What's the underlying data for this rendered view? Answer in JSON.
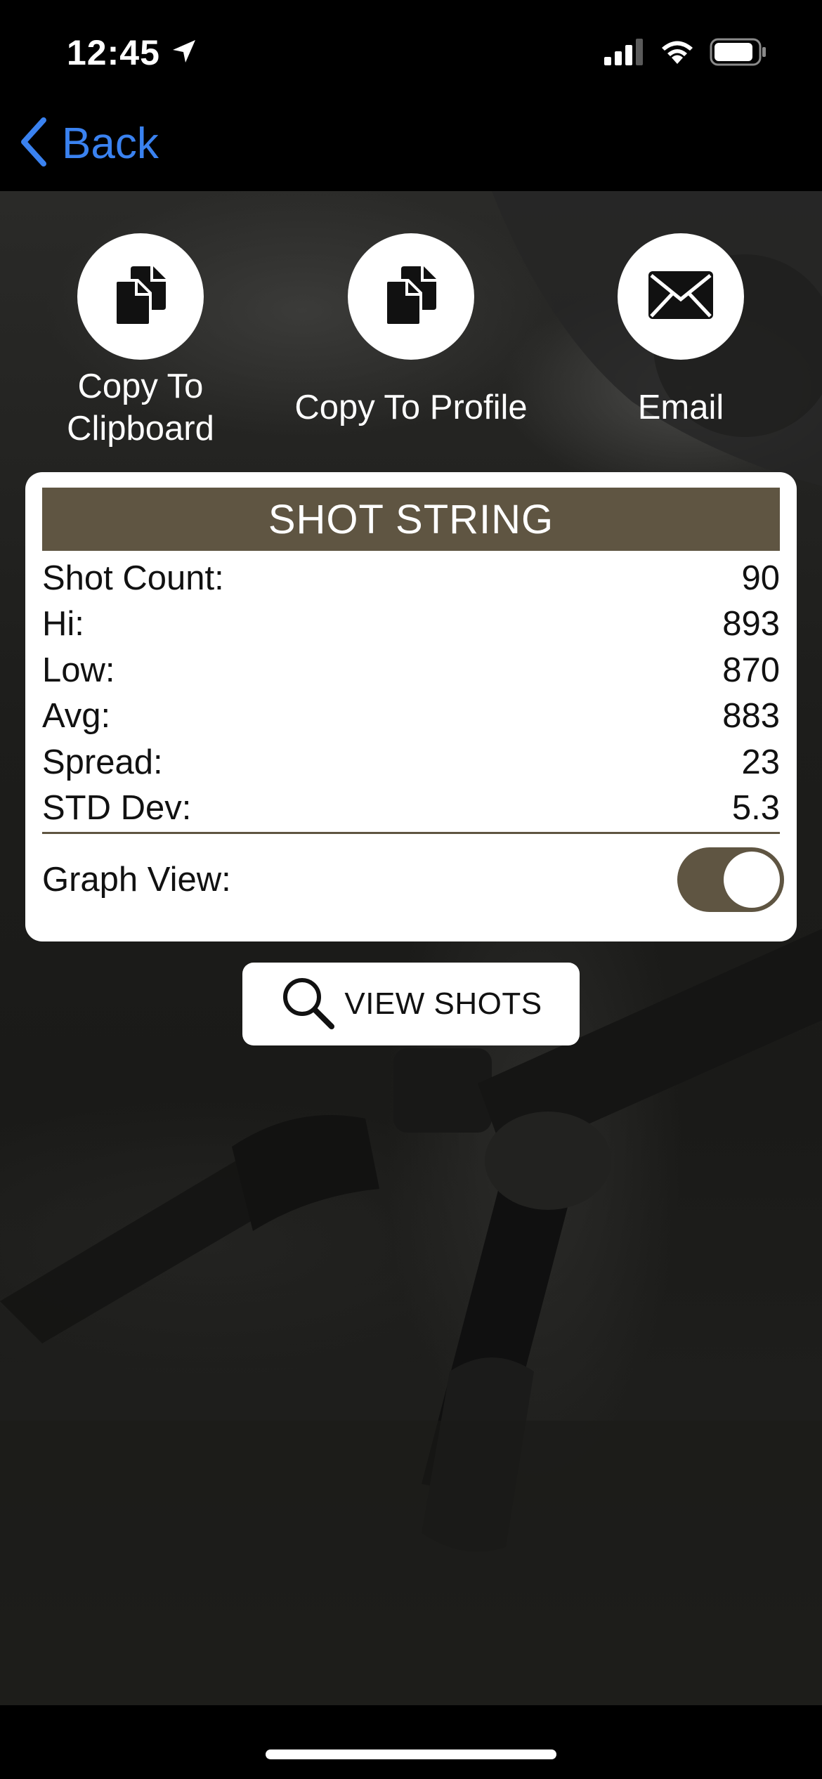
{
  "status_bar": {
    "time": "12:45",
    "icons": [
      "location-arrow-icon",
      "cellular-signal-icon",
      "wifi-icon",
      "battery-icon"
    ]
  },
  "nav": {
    "back_label": "Back",
    "back_icon": "chevron-left-icon"
  },
  "actions": [
    {
      "label": "Copy To\nClipboard",
      "icon": "copy-documents-icon"
    },
    {
      "label": "Copy To Profile",
      "icon": "copy-documents-icon"
    },
    {
      "label": "Email",
      "icon": "envelope-icon"
    }
  ],
  "card": {
    "title": "SHOT STRING",
    "stats": [
      {
        "label": "Shot Count:",
        "value": "90"
      },
      {
        "label": "Hi:",
        "value": "893"
      },
      {
        "label": "Low:",
        "value": "870"
      },
      {
        "label": "Avg:",
        "value": "883"
      },
      {
        "label": "Spread:",
        "value": "23"
      },
      {
        "label": "STD Dev:",
        "value": "5.3"
      }
    ],
    "graph_view_label": "Graph View:",
    "graph_view_on": true
  },
  "view_shots": {
    "label": "VIEW SHOTS",
    "icon": "magnifier-icon"
  },
  "colors": {
    "accent_brown": "#5f5542",
    "link_blue": "#3a82f0"
  }
}
